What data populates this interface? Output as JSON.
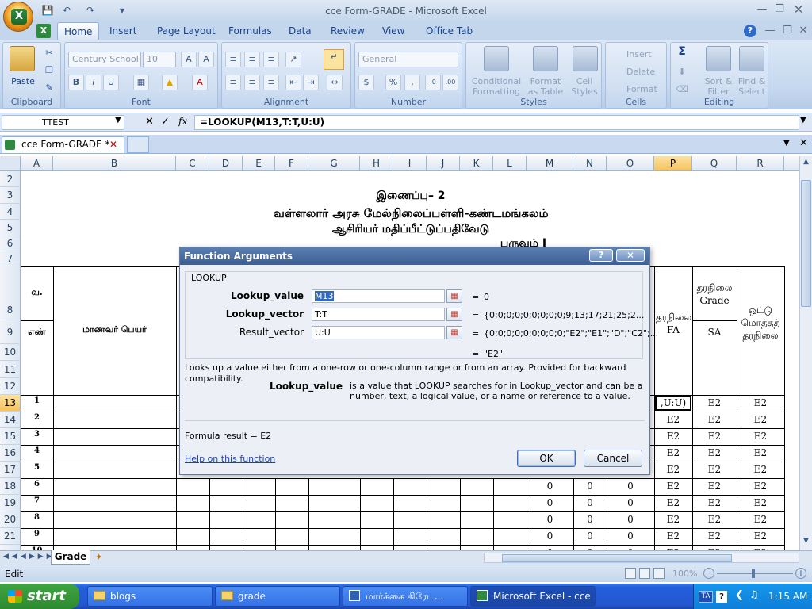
{
  "window": {
    "title": "cce Form-GRADE - Microsoft Excel"
  },
  "ribbon": {
    "tabs": [
      "Home",
      "Insert",
      "Page Layout",
      "Formulas",
      "Data",
      "Review",
      "View",
      "Office Tab"
    ],
    "font_name": "Century School",
    "font_size": "10",
    "number_format": "General",
    "groups": {
      "clipboard": "Clipboard",
      "font": "Font",
      "alignment": "Alignment",
      "number": "Number",
      "styles": "Styles",
      "cells": "Cells",
      "editing": "Editing"
    },
    "paste": "Paste",
    "conditional": "Conditional",
    "formatting": "Formatting",
    "format_as": "Format",
    "as_table": "as Table",
    "cell": "Cell",
    "styles_btn": "Styles",
    "insert": "Insert",
    "delete": "Delete",
    "format": "Format",
    "sort": "Sort &",
    "filter": "Filter",
    "find": "Find &",
    "select": "Select",
    "sigma": "Σ"
  },
  "formula_bar": {
    "name_box": "TTEST",
    "fx": "fx",
    "formula": "=LOOKUP(M13,T:T,U:U)"
  },
  "doc_tab": "cce Form-GRADE *",
  "sheet": {
    "columns": [
      "A",
      "B",
      "C",
      "D",
      "E",
      "F",
      "G",
      "H",
      "I",
      "J",
      "K",
      "L",
      "M",
      "N",
      "O",
      "P",
      "Q",
      "R"
    ],
    "rows": [
      "2",
      "3",
      "4",
      "5",
      "6",
      "7",
      "8",
      "9",
      "10",
      "11",
      "12",
      "13",
      "14",
      "15",
      "16",
      "17",
      "18",
      "19",
      "20",
      "21",
      ""
    ],
    "title1": "இணைப்பு– 2",
    "title2": "வள்ளலார் அரசு மேல்நிலைப்பள்ளி-கண்டமங்கலம்",
    "title3": "ஆசிரியர் மதிப்பீட்டுப்பதிவேடு",
    "title4_partial": "பருவம் I",
    "hdr_va": "வ.",
    "hdr_en": "எண்",
    "hdr_name": "மாணவர் பெயர்",
    "hdr_p": "தரநிலை FA",
    "hdr_q1": "தரநிலை Grade",
    "hdr_q2": "SA",
    "hdr_r": "ஒட்டு மொத்தத் தரநிலை",
    "serials": [
      "1",
      "2",
      "3",
      "4",
      "5",
      "6",
      "7",
      "8",
      "9",
      "10"
    ],
    "zero": "0",
    "grade": "E2",
    "edit_cell": ",U:U)",
    "sheet_tab": "Grade"
  },
  "dialog": {
    "title": "Function Arguments",
    "func": "LOOKUP",
    "args": [
      {
        "label": "Lookup_value",
        "value": "M13",
        "result": "0"
      },
      {
        "label": "Lookup_vector",
        "value": "T:T",
        "result": "{0;0;0;0;0;0;0;0;0;9;13;17;21;25;2..."
      },
      {
        "label": "Result_vector",
        "value": "U:U",
        "result": "{0;0;0;0;0;0;0;0;0;\"E2\";\"E1\";\"D\";\"C2\";..."
      }
    ],
    "eq": "=",
    "overall": "\"E2\"",
    "description": "Looks up a value either from a one-row or one-column range or from an array. Provided for backward compatibility.",
    "arg_name": "Lookup_value",
    "arg_desc": "is a value that LOOKUP searches for in Lookup_vector and can be a number, text, a logical value, or a name or reference to a value.",
    "formula_result": "Formula result =   E2",
    "help": "Help on this function",
    "ok": "OK",
    "cancel": "Cancel"
  },
  "status": {
    "mode": "Edit",
    "zoom": "100%"
  },
  "taskbar": {
    "start": "start",
    "items": [
      "blogs",
      "grade",
      "மார்க்கை கிரேட...",
      "Microsoft Excel - cce ..."
    ],
    "time": "1:15 AM",
    "lang": "TA"
  },
  "colors": {
    "accent": "#15428b",
    "selected_header": "#f7c25e",
    "taskbar": "#245edb"
  }
}
